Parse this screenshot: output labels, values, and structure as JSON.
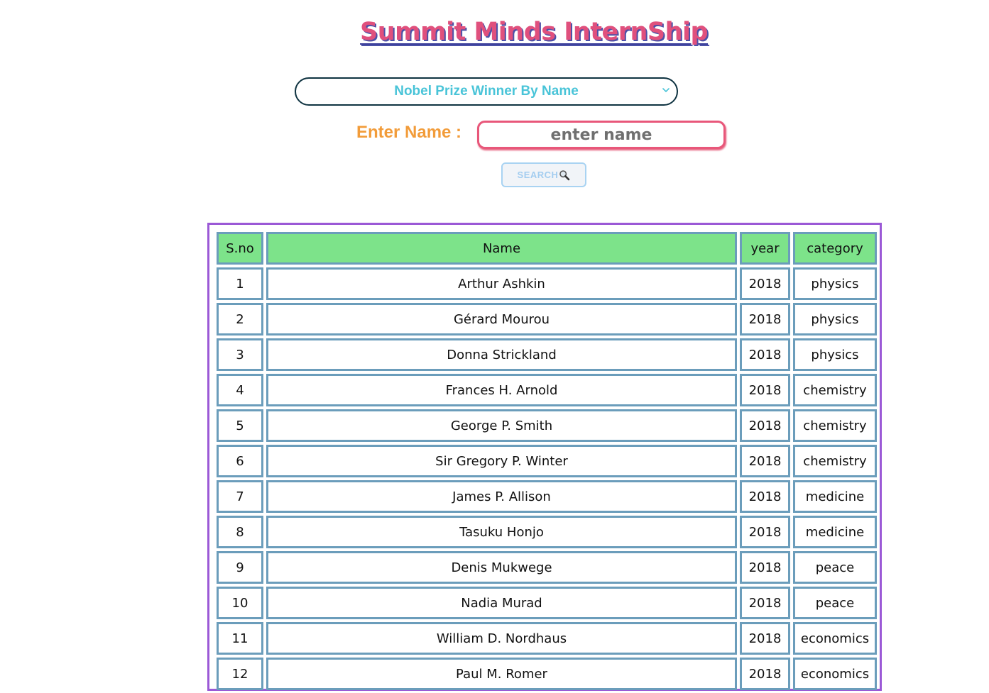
{
  "page": {
    "title": "Summit Minds InternShip"
  },
  "filter": {
    "selected_option": "Nobel Prize Winner By Name"
  },
  "search": {
    "label": "Enter Name :",
    "placeholder": "enter name",
    "button_label": "SEARCH"
  },
  "table": {
    "headers": [
      "S.no",
      "Name",
      "year",
      "category"
    ],
    "rows": [
      [
        "1",
        "Arthur Ashkin",
        "2018",
        "physics"
      ],
      [
        "2",
        "Gérard Mourou",
        "2018",
        "physics"
      ],
      [
        "3",
        "Donna Strickland",
        "2018",
        "physics"
      ],
      [
        "4",
        "Frances H. Arnold",
        "2018",
        "chemistry"
      ],
      [
        "5",
        "George P. Smith",
        "2018",
        "chemistry"
      ],
      [
        "6",
        "Sir Gregory P. Winter",
        "2018",
        "chemistry"
      ],
      [
        "7",
        "James P. Allison",
        "2018",
        "medicine"
      ],
      [
        "8",
        "Tasuku Honjo",
        "2018",
        "medicine"
      ],
      [
        "9",
        "Denis Mukwege",
        "2018",
        "peace"
      ],
      [
        "10",
        "Nadia Murad",
        "2018",
        "peace"
      ],
      [
        "11",
        "William D. Nordhaus",
        "2018",
        "economics"
      ],
      [
        "12",
        "Paul M. Romer",
        "2018",
        "economics"
      ]
    ]
  },
  "colors": {
    "title": "#e0507d",
    "title_shadow": "#4b51a8",
    "select_text": "#49c4d8",
    "label": "#f29c3a",
    "input_border": "#e8577a",
    "header_bg": "#7de38a",
    "cell_border": "#6b9dbb",
    "frame_border": "#9b59d6"
  },
  "icons": {
    "select": "chevron-down-icon",
    "search": "magnifier-icon"
  }
}
